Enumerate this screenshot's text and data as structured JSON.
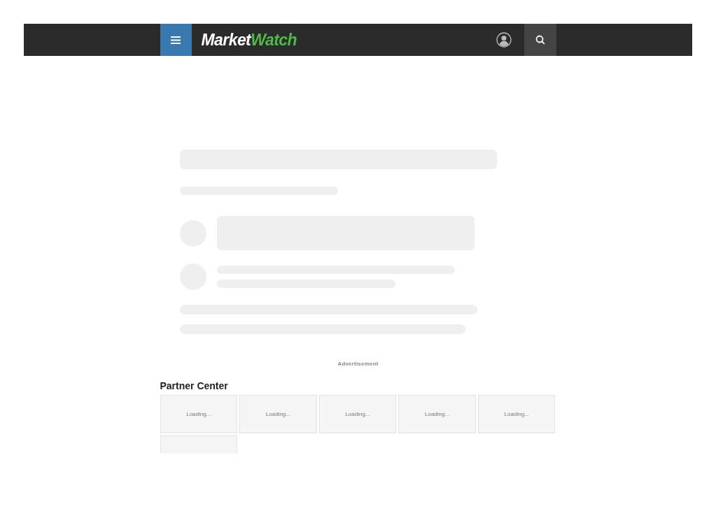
{
  "header": {
    "logo": [
      "Market",
      "Watch"
    ]
  },
  "advertisement": "Advertisement",
  "partner_center": {
    "title": "Partner Center",
    "cards": [
      {
        "kind": "loading",
        "text": "Loading..."
      },
      {
        "kind": "loading",
        "text": "Loading..."
      },
      {
        "kind": "loading",
        "text": "Loading..."
      },
      {
        "kind": "loading",
        "text": "Loading..."
      },
      {
        "kind": "loading",
        "text": "Loading..."
      },
      {
        "kind": "blank"
      }
    ]
  }
}
